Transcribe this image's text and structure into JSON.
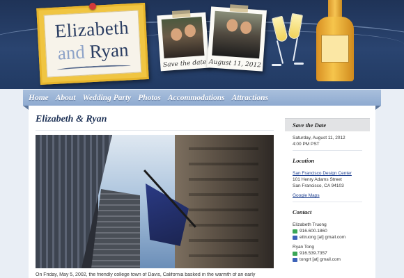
{
  "header": {
    "logo_line1": "Elizabeth",
    "logo_line2_and": "and",
    "logo_line2_name": "Ryan",
    "photo1_caption": "Save the date",
    "photo2_caption": "August 11, 2012"
  },
  "nav": {
    "items": [
      "Home",
      "About",
      "Wedding Party",
      "Photos",
      "Accommodations",
      "Attractions"
    ]
  },
  "main": {
    "title": "Elizabeth & Ryan",
    "intro": "On Friday, May 5, 2002, the friendly college town of Davis, California basked in the warmth of an early"
  },
  "sidebar": {
    "save_date_heading": "Save the Date",
    "date": "Saturday, August 11, 2012",
    "time": "4:00 PM PST",
    "location_heading": "Location",
    "venue": "San Francisco Design Center",
    "address1": "101 Henry Adams Street",
    "address2": "San Francisco, CA 94103",
    "maps_link": "Google Maps",
    "contact_heading": "Contact",
    "contact1_name": "Elizabeth Truong",
    "contact1_phone": "916.600.1860",
    "contact1_email": "ettruong [at] gmail.com",
    "contact2_name": "Ryan Tong",
    "contact2_phone": "916.539.7357",
    "contact2_email": "tongrt [at] gmail.com"
  },
  "colors": {
    "header_bg": "#233c66",
    "nav_bg": "#9cb5d8",
    "title": "#1f3357",
    "link": "#1d3f8f"
  }
}
